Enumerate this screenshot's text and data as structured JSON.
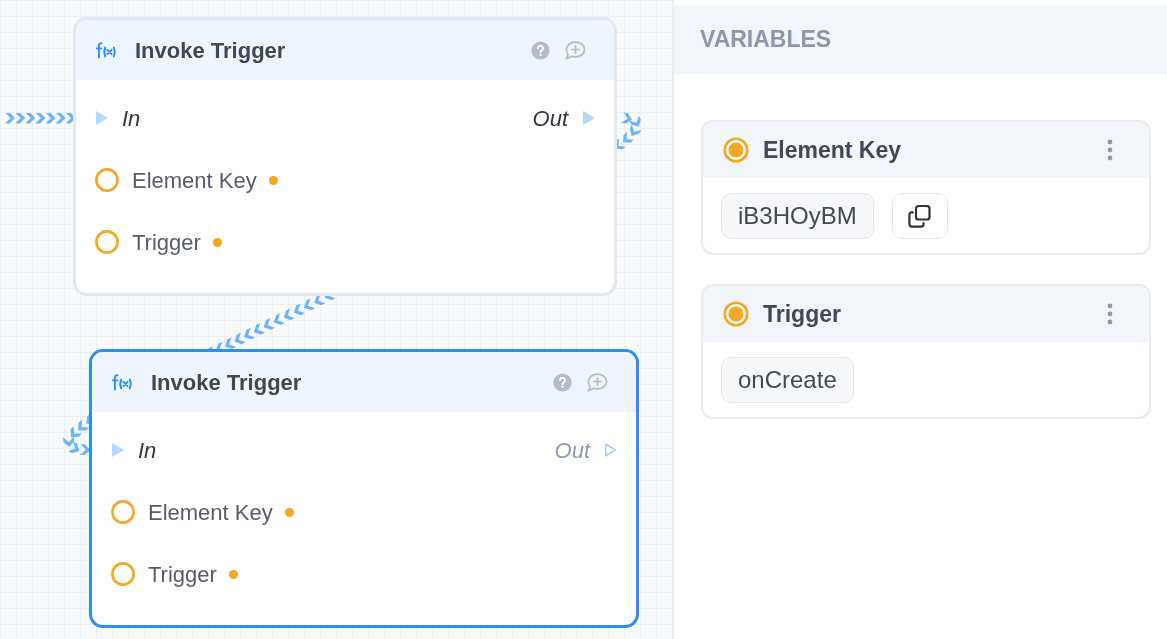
{
  "canvas": {
    "nodes": [
      {
        "title": "Invoke Trigger",
        "selected": false,
        "exec_in": {
          "label": "In",
          "connected": true
        },
        "exec_out": {
          "label": "Out",
          "connected": true
        },
        "inputs": [
          {
            "label": "Element Key",
            "connected": false,
            "has_value": true
          },
          {
            "label": "Trigger",
            "connected": false,
            "has_value": true
          }
        ]
      },
      {
        "title": "Invoke Trigger",
        "selected": true,
        "exec_in": {
          "label": "In",
          "connected": true
        },
        "exec_out": {
          "label": "Out",
          "connected": false
        },
        "inputs": [
          {
            "label": "Element Key",
            "connected": false,
            "has_value": true
          },
          {
            "label": "Trigger",
            "connected": false,
            "has_value": true
          }
        ]
      }
    ]
  },
  "variables_panel": {
    "title": "VARIABLES",
    "variables": [
      {
        "name": "Element Key",
        "value": "iB3HOyBM",
        "copyable": true
      },
      {
        "name": "Trigger",
        "value": "onCreate",
        "copyable": false
      }
    ]
  }
}
